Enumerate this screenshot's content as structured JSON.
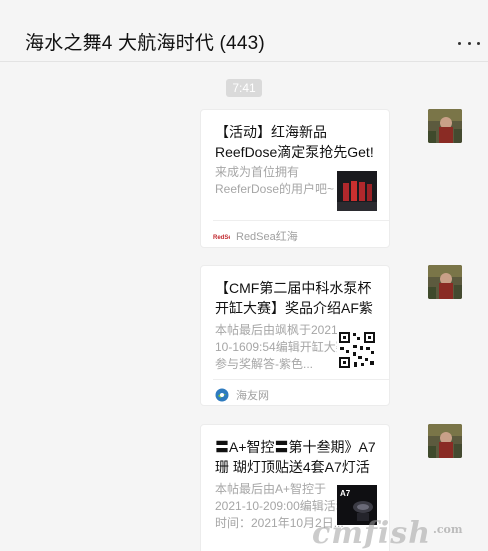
{
  "window": {
    "pin_icon": "pin-icon",
    "minimize_icon": "minimize-icon",
    "maximize_icon": "maximize-icon",
    "close_icon": "close-icon"
  },
  "chat": {
    "title": "海水之舞4 大航海时代 (443)",
    "more_icon": "more-dots-icon"
  },
  "timestamp": "7:41",
  "messages": [
    {
      "title": "【活动】红海新品ReefDose滴定泵抢先Get!",
      "description": "来成为首位拥有ReeferDose的用户吧~",
      "source": "RedSea红海",
      "source_icon": "redsea-logo-icon"
    },
    {
      "title": "【CMF第二届中科水泵杯开缸大赛】奖品介绍AF紫色森林篇，...",
      "description": "本帖最后由飒枫于2021-10-1609:54编辑开缸大赛参与奖解答-紫色...",
      "source": "海友网",
      "source_icon": "haiyou-logo-icon"
    },
    {
      "title": "〓A+智控〓第十叁期》A7珊 瑚灯顶贴送4套A7灯活动开始!",
      "description": "本帖最后由A+智控于2021-10-209:00编辑活动时间：2021年10月2日...",
      "thumb_label": "A7"
    }
  ],
  "watermark": {
    "text": "cmfish",
    "suffix": ".com"
  }
}
